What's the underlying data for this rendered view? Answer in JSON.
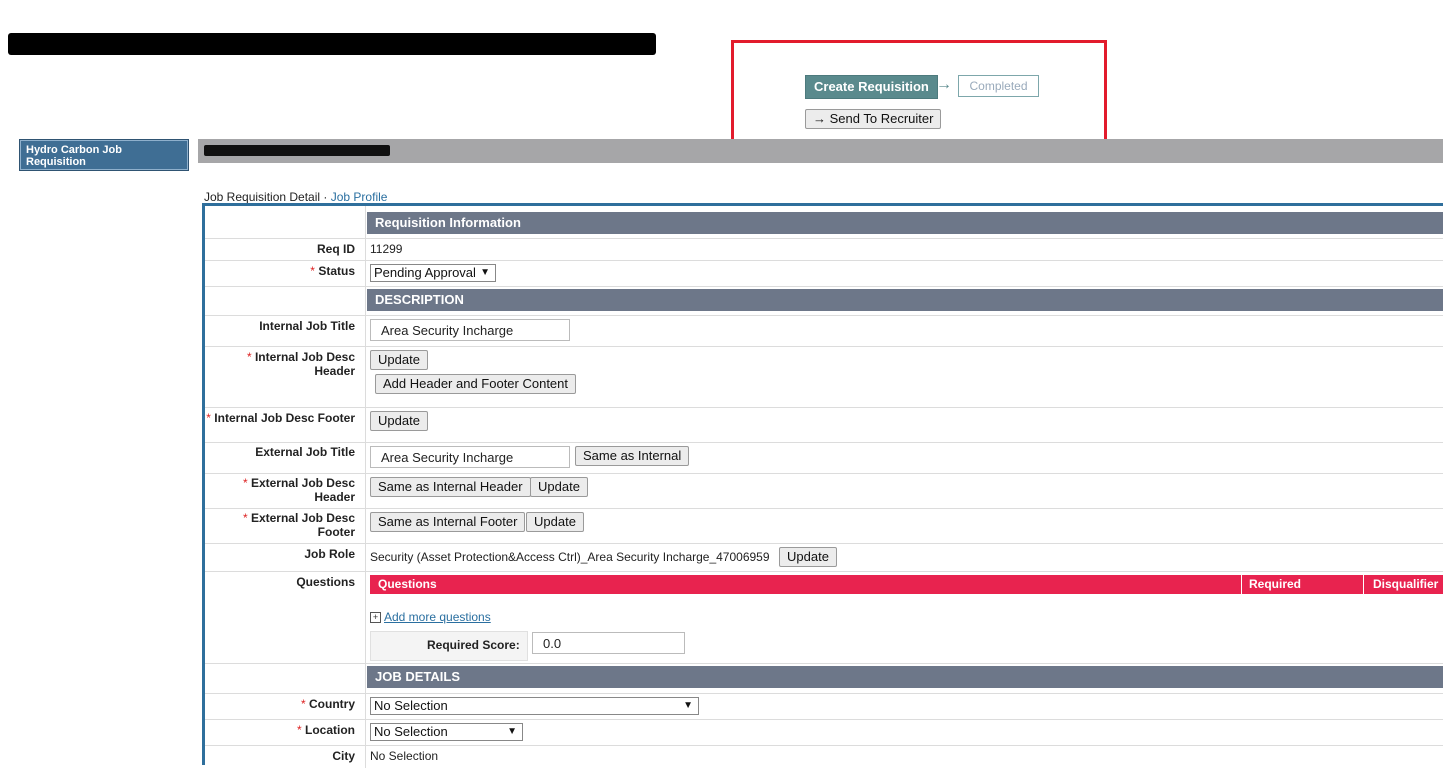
{
  "workflow": {
    "create_label": "Create Requisition",
    "completed_label": "Completed",
    "send_label": "Send To Recruiter"
  },
  "sidebar": {
    "item_label": "Hydro Carbon Job Requisition"
  },
  "breadcrumb": {
    "current": "Job Requisition Detail",
    "separator": "·",
    "link": "Job Profile"
  },
  "form": {
    "sections": {
      "requisition_info": "Requisition Information",
      "description": "DESCRIPTION",
      "job_details": "JOB DETAILS"
    },
    "req_id": {
      "label": "Req ID",
      "value": "11299"
    },
    "status": {
      "label": "Status",
      "value": "Pending Approval"
    },
    "internal_job_title": {
      "label": "Internal Job Title",
      "value": "Area Security Incharge"
    },
    "internal_desc_header": {
      "label": "Internal Job Desc Header",
      "update": "Update",
      "add_hf": "Add Header and Footer Content"
    },
    "internal_desc_footer": {
      "label": "Internal Job Desc Footer",
      "update": "Update"
    },
    "external_job_title": {
      "label": "External Job Title",
      "value": "Area Security Incharge",
      "same_btn": "Same as Internal"
    },
    "external_desc_header": {
      "label": "External Job Desc Header",
      "same_btn": "Same as Internal Header",
      "update": "Update"
    },
    "external_desc_footer": {
      "label": "External Job Desc Footer",
      "same_btn": "Same as Internal Footer",
      "update": "Update"
    },
    "job_role": {
      "label": "Job Role",
      "value": "Security (Asset Protection&Access Ctrl)_Area Security Incharge_47006959",
      "update": "Update"
    },
    "questions": {
      "label": "Questions",
      "col_questions": "Questions",
      "col_required": "Required",
      "col_disqualifier": "Disqualifier",
      "add_more": "Add more questions",
      "required_score_label": "Required Score:",
      "required_score_value": "0.0"
    },
    "country": {
      "label": "Country",
      "value": "No Selection"
    },
    "location": {
      "label": "Location",
      "value": "No Selection"
    },
    "city": {
      "label": "City",
      "value": "No Selection"
    }
  },
  "colors": {
    "accent_red": "#e21b2c",
    "section_header": "#6d7789",
    "questions_header": "#e8234f",
    "sidebar": "#3f6e94"
  }
}
